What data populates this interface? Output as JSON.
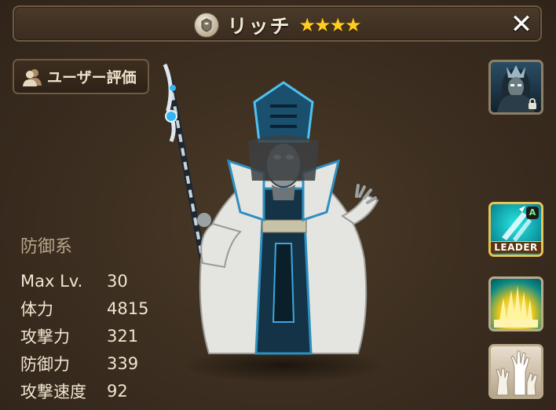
{
  "header": {
    "title": "リッチ",
    "stars": "★★★★",
    "close_label": "✕"
  },
  "review_button": {
    "label": "ユーザー評価"
  },
  "stats": {
    "category": "防御系",
    "rows": [
      {
        "label": "Max Lv.",
        "value": "30"
      },
      {
        "label": "体力",
        "value": "4815"
      },
      {
        "label": "攻撃力",
        "value": "321"
      },
      {
        "label": "防御力",
        "value": "339"
      },
      {
        "label": "攻撃速度",
        "value": "92"
      }
    ]
  },
  "skills": {
    "leader_label": "LEADER",
    "leader_badge": "A"
  }
}
